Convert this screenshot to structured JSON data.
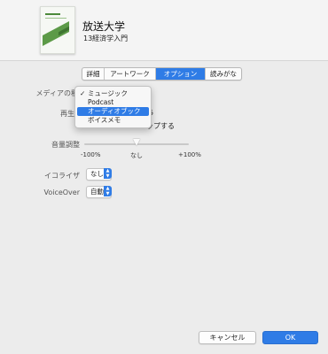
{
  "header": {
    "title": "放送大学",
    "subtitle": "13経済学入門"
  },
  "tabs": [
    {
      "label": "詳細"
    },
    {
      "label": "アートワーク"
    },
    {
      "label": "オプション",
      "active": true
    },
    {
      "label": "読みがな"
    }
  ],
  "labels": {
    "media_kind": "メディアの種類",
    "playback_partial": "再生",
    "volume": "音量調整",
    "equalizer": "イコライザ",
    "voiceover": "VoiceOver"
  },
  "partial_text": {
    "playback_value_fragment": "5",
    "skip_fragment": "ップする"
  },
  "media_menu": {
    "check": "✓",
    "items": [
      "ミュージック",
      "Podcast",
      "オーディオブック",
      "ボイスメモ"
    ],
    "checked_item": "ミュージック",
    "highlighted_item": "オーディオブック"
  },
  "volume_slider": {
    "min_label": "-100%",
    "mid_label": "なし",
    "max_label": "+100%",
    "value_fraction": 0.5
  },
  "equalizer": {
    "selected": "なし"
  },
  "voiceover": {
    "selected": "自動"
  },
  "stepper_glyphs": {
    "up": "▲",
    "down": "▼"
  },
  "buttons": {
    "cancel": "キャンセル",
    "ok": "OK"
  },
  "colors": {
    "accent": "#2f7ce6",
    "background": "#ececec"
  }
}
